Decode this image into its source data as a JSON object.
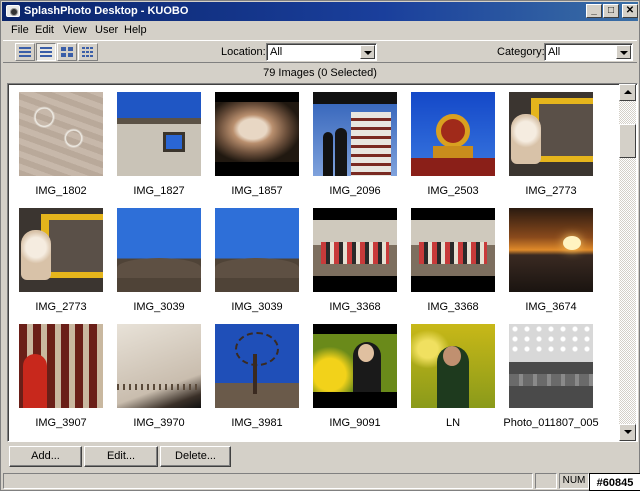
{
  "window": {
    "title": "SplashPhoto Desktop - KUOBO",
    "minimize_glyph": "_",
    "maximize_glyph": "□",
    "close_glyph": "✕"
  },
  "menu": [
    {
      "label": "File",
      "icon": ""
    },
    {
      "label": "Edit",
      "icon": ""
    },
    {
      "label": "View",
      "icon": ""
    },
    {
      "label": "User",
      "icon": ""
    },
    {
      "label": "Help",
      "icon": ""
    }
  ],
  "toolbar": {
    "location_label": "Location:",
    "location_value": "All",
    "category_label": "Category:",
    "category_value": "All",
    "view_icons": [
      "list-view-icon",
      "details-view-icon",
      "large-thumbnails-icon",
      "small-thumbnails-icon"
    ]
  },
  "count_text": "79 Images (0 Selected)",
  "thumbnails": [
    {
      "caption": "IMG_1802"
    },
    {
      "caption": "IMG_1827"
    },
    {
      "caption": "IMG_1857"
    },
    {
      "caption": "IMG_2096"
    },
    {
      "caption": "IMG_2503"
    },
    {
      "caption": "IMG_2773"
    },
    {
      "caption": "IMG_2773"
    },
    {
      "caption": "IMG_3039"
    },
    {
      "caption": "IMG_3039"
    },
    {
      "caption": "IMG_3368"
    },
    {
      "caption": "IMG_3368"
    },
    {
      "caption": "IMG_3674"
    },
    {
      "caption": "IMG_3907"
    },
    {
      "caption": "IMG_3970"
    },
    {
      "caption": "IMG_3981"
    },
    {
      "caption": "IMG_9091"
    },
    {
      "caption": "LN"
    },
    {
      "caption": "Photo_011807_005"
    }
  ],
  "buttons": {
    "add": "Add...",
    "edit": "Edit...",
    "delete": "Delete..."
  },
  "status": {
    "num": "NUM",
    "watermark": "#60845"
  }
}
